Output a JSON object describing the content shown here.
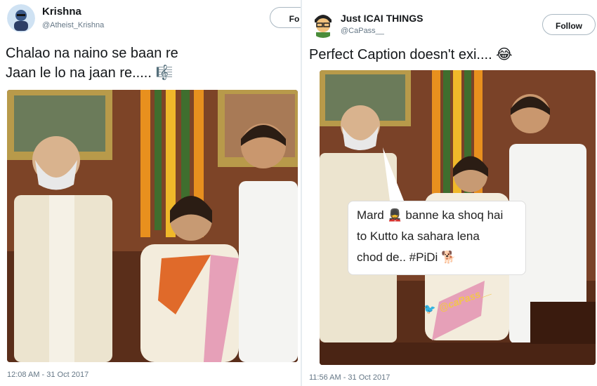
{
  "left_tweet": {
    "name": "Krishna",
    "handle": "@Atheist_Krishna",
    "follow_label": "Fo",
    "text_line1": "Chalao na naino se baan re",
    "text_line2": "Jaan le lo na jaan re..... 🎼",
    "timestamp": "12:08 AM - 31 Oct 2017"
  },
  "right_tweet": {
    "name": "Just ICAI THINGS",
    "handle": "@CaPass__",
    "follow_label": "Follow",
    "text": "Perfect Caption doesn't exi.... 😂",
    "caption_line1": "Mard 💂 banne ka shoq hai",
    "caption_line2": "to Kutto ka sahara lena",
    "caption_line3": "chod de.. #PiDi 🐕",
    "watermark": "@caPass__",
    "timestamp": "11:56 AM - 31 Oct 2017"
  },
  "colors": {
    "text": "#14171a",
    "secondary": "#657786",
    "border": "#e6ecf0",
    "accent": "#1da1f2"
  },
  "icons": {
    "left_avatar": "cartoon-avatar",
    "right_avatar": "cartoon-avatar",
    "twitter_bird": "bird-icon"
  }
}
